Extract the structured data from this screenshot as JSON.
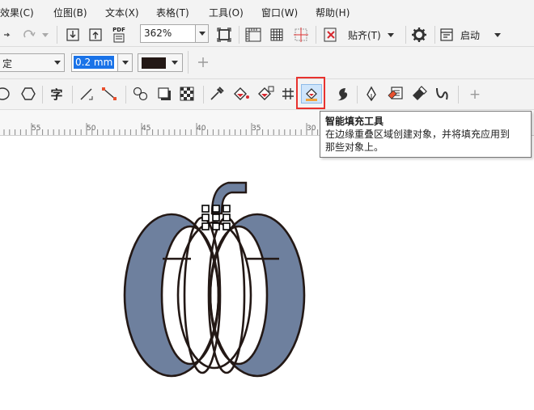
{
  "menu": {
    "items": [
      {
        "label": "效果(C)"
      },
      {
        "label": "位图(B)"
      },
      {
        "label": "文本(X)"
      },
      {
        "label": "表格(T)"
      },
      {
        "label": "工具(O)"
      },
      {
        "label": "窗口(W)"
      },
      {
        "label": "帮助(H)"
      }
    ]
  },
  "toolbar": {
    "zoom_value": "362%",
    "snap_label": "贴齐(T)",
    "launch_label": "启动",
    "pdf_label": "PDF"
  },
  "properties": {
    "line_style_partial": "定",
    "outline_width": "0.2 mm",
    "outline_color": "#231815"
  },
  "toolbox": {
    "text_tool_glyph": "字",
    "add_label": "+"
  },
  "ruler": {
    "ticks": [
      "55",
      "50",
      "45",
      "40",
      "35",
      "30"
    ]
  },
  "tooltip": {
    "title": "智能填充工具",
    "line1": "在边缘重叠区域创建对象，并将填充应用到",
    "line2": "那些对象上。"
  },
  "drawing": {
    "fill_color": "#6e809e",
    "stroke_color": "#231815"
  }
}
